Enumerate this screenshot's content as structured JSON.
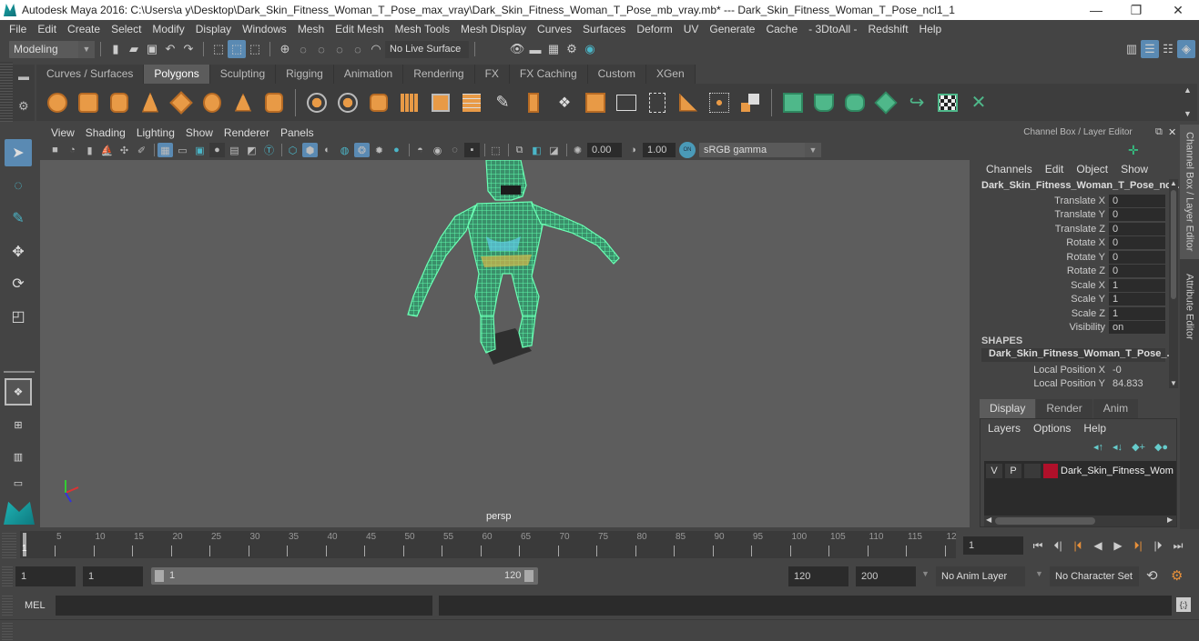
{
  "window": {
    "title": "Autodesk Maya 2016: C:\\Users\\a y\\Desktop\\Dark_Skin_Fitness_Woman_T_Pose_max_vray\\Dark_Skin_Fitness_Woman_T_Pose_mb_vray.mb*   ---   Dark_Skin_Fitness_Woman_T_Pose_ncl1_1",
    "minimize": "—",
    "maximize": "❐",
    "close": "✕"
  },
  "menubar": [
    "File",
    "Edit",
    "Create",
    "Select",
    "Modify",
    "Display",
    "Windows",
    "Mesh",
    "Edit Mesh",
    "Mesh Tools",
    "Mesh Display",
    "Curves",
    "Surfaces",
    "Deform",
    "UV",
    "Generate",
    "Cache",
    "- 3DtoAll -",
    "Redshift",
    "Help"
  ],
  "statusline": {
    "mode": "Modeling",
    "live_surface": "No Live Surface"
  },
  "shelf": {
    "tabs": [
      "Curves / Surfaces",
      "Polygons",
      "Sculpting",
      "Rigging",
      "Animation",
      "Rendering",
      "FX",
      "FX Caching",
      "Custom",
      "XGen"
    ],
    "active_tab": "Polygons"
  },
  "viewport": {
    "menu": [
      "View",
      "Shading",
      "Lighting",
      "Show",
      "Renderer",
      "Panels"
    ],
    "exposure": "0.00",
    "gamma": "1.00",
    "color_mgmt_toggle": "ON",
    "color_space": "sRGB gamma",
    "camera": "persp"
  },
  "channel_box": {
    "header": "Channel Box / Layer Editor",
    "menu": [
      "Channels",
      "Edit",
      "Object",
      "Show"
    ],
    "object_name": "Dark_Skin_Fitness_Woman_T_Pose_nc...",
    "channels": [
      {
        "label": "Translate X",
        "value": "0"
      },
      {
        "label": "Translate Y",
        "value": "0"
      },
      {
        "label": "Translate Z",
        "value": "0"
      },
      {
        "label": "Rotate X",
        "value": "0"
      },
      {
        "label": "Rotate Y",
        "value": "0"
      },
      {
        "label": "Rotate Z",
        "value": "0"
      },
      {
        "label": "Scale X",
        "value": "1"
      },
      {
        "label": "Scale Y",
        "value": "1"
      },
      {
        "label": "Scale Z",
        "value": "1"
      },
      {
        "label": "Visibility",
        "value": "on"
      }
    ],
    "shapes_label": "SHAPES",
    "shape_name": "Dark_Skin_Fitness_Woman_T_Pose_...",
    "shape_channels": [
      {
        "label": "Local Position X",
        "value": "-0"
      },
      {
        "label": "Local Position Y",
        "value": "84.833"
      }
    ]
  },
  "side_tabs": [
    "Channel Box / Layer Editor",
    "Attribute Editor"
  ],
  "layer_editor": {
    "tabs": [
      "Display",
      "Render",
      "Anim"
    ],
    "active_tab": "Display",
    "menu": [
      "Layers",
      "Options",
      "Help"
    ],
    "layers": [
      {
        "v": "V",
        "p": "P",
        "color": "#b0102a",
        "name": "Dark_Skin_Fitness_Wom"
      }
    ]
  },
  "timeline": {
    "ticks": [
      "5",
      "10",
      "15",
      "20",
      "25",
      "30",
      "35",
      "40",
      "45",
      "50",
      "55",
      "60",
      "65",
      "70",
      "75",
      "80",
      "85",
      "90",
      "95",
      "100",
      "105",
      "110",
      "115",
      "12"
    ],
    "current_frame_marker": "1",
    "current_frame": "1"
  },
  "range": {
    "start": "1",
    "playback_start": "1",
    "slider_start": "1",
    "slider_end": "120",
    "playback_end": "120",
    "end": "200",
    "anim_layer": "No Anim Layer",
    "character_set": "No Character Set"
  },
  "command_line": {
    "language": "MEL"
  }
}
